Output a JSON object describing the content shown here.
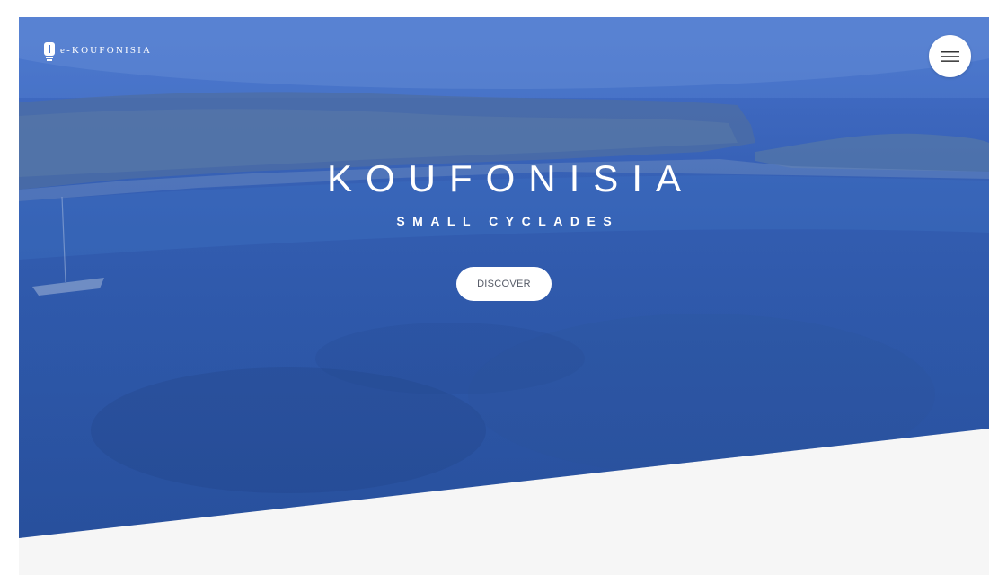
{
  "header": {
    "logo_text": "e-KOUFONISIA",
    "logo_icon": "lighthouse-icon",
    "menu_icon": "hamburger-menu-icon"
  },
  "hero": {
    "title": "KOUFONISIA",
    "subtitle": "SMALL CYCLADES",
    "cta_label": "DISCOVER"
  },
  "colors": {
    "overlay_blue": "#3560b2",
    "background": "#f6f6f6",
    "button": "#ffffff",
    "button_text": "#555a66"
  }
}
